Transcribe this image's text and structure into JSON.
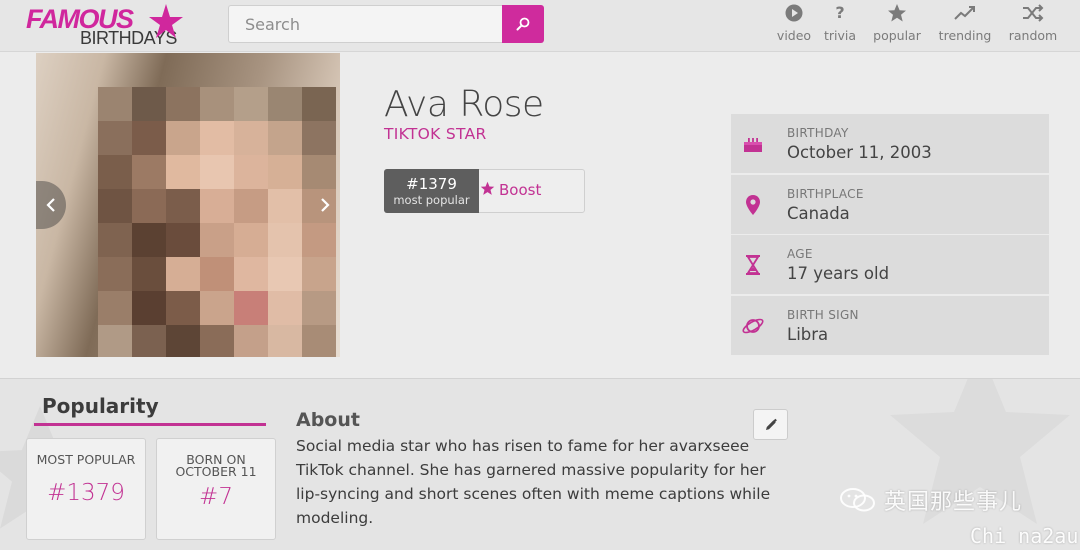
{
  "header": {
    "logo": {
      "line1": "FAMOUS",
      "line2": "BIRTHDAYS"
    },
    "search": {
      "placeholder": "Search"
    },
    "nav": [
      {
        "label": "video",
        "icon": "play-icon"
      },
      {
        "label": "trivia",
        "icon": "question-icon"
      },
      {
        "label": "popular",
        "icon": "star-icon"
      },
      {
        "label": "trending",
        "icon": "trending-icon"
      },
      {
        "label": "random",
        "icon": "shuffle-icon"
      }
    ]
  },
  "profile": {
    "name": "Ava Rose",
    "profession": "TIKTOK STAR",
    "rank": {
      "number": "#1379",
      "label": "most popular"
    },
    "boost_label": "Boost"
  },
  "facts": [
    {
      "label": "BIRTHDAY",
      "value": "October 11, 2003",
      "icon": "cake-icon"
    },
    {
      "label": "BIRTHPLACE",
      "value": "Canada",
      "icon": "location-pin-icon"
    },
    {
      "label": "AGE",
      "value": "17 years old",
      "icon": "hourglass-icon"
    },
    {
      "label": "BIRTH SIGN",
      "value": "Libra",
      "icon": "planet-icon"
    }
  ],
  "popularity": {
    "title": "Popularity",
    "cards": [
      {
        "caption": "MOST POPULAR",
        "value": "#1379"
      },
      {
        "caption_line1": "BORN ON",
        "caption_line2": "OCTOBER 11",
        "value": "#7"
      }
    ]
  },
  "about": {
    "title": "About",
    "text": "Social media star who has risen to fame for her avarxseee TikTok channel. She has garnered massive popularity for her lip-syncing and short scenes often with meme captions while modeling."
  },
  "watermark": {
    "text": "英国那些事儿",
    "source": "Chi na2au"
  },
  "colors": {
    "accent": "#c23293",
    "search_button": "#cf2b9d",
    "rank_badge": "#5e5e5e"
  }
}
